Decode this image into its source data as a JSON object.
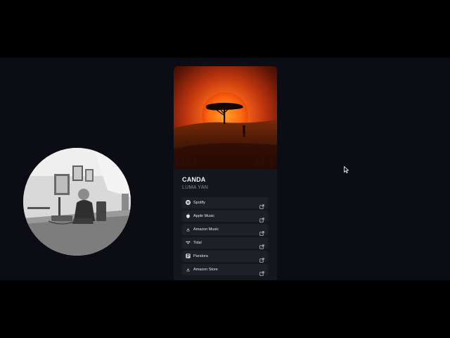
{
  "release": {
    "title": "CANDA",
    "artist": "LUMA YAN"
  },
  "links": [
    {
      "label": "Spotify",
      "icon": "spotify-icon"
    },
    {
      "label": "Apple Music",
      "icon": "apple-icon"
    },
    {
      "label": "Amazon Music",
      "icon": "amazon-icon"
    },
    {
      "label": "Tidal",
      "icon": "tidal-icon"
    },
    {
      "label": "Pandora",
      "icon": "pandora-icon"
    },
    {
      "label": "Amazon Store",
      "icon": "amazon-icon"
    }
  ],
  "colors": {
    "page_background": "#0b0c14",
    "card_background": "#16171d",
    "link_background": "#1f2027",
    "title_text": "#f1f1f4",
    "artist_text": "#8a8c97",
    "sun": "#ff7a1a"
  }
}
